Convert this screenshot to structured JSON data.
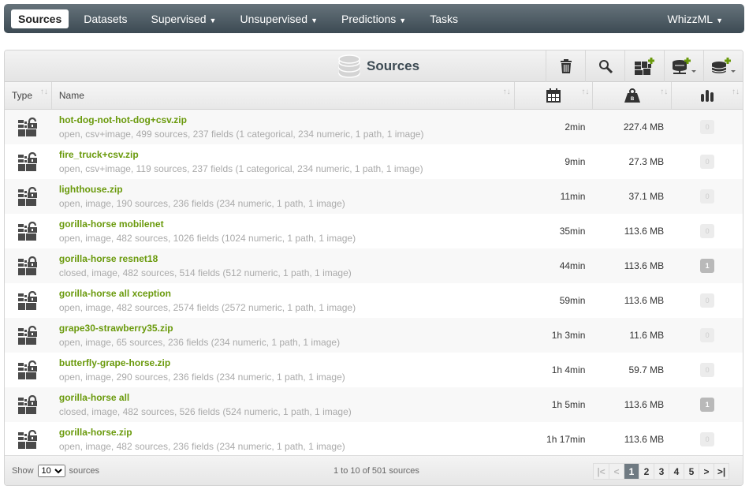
{
  "nav": {
    "items": [
      {
        "label": "Sources",
        "active": true
      },
      {
        "label": "Datasets"
      },
      {
        "label": "Supervised",
        "dropdown": true
      },
      {
        "label": "Unsupervised",
        "dropdown": true
      },
      {
        "label": "Predictions",
        "dropdown": true
      },
      {
        "label": "Tasks"
      }
    ],
    "right": {
      "label": "WhizzML",
      "dropdown": true
    }
  },
  "panel": {
    "title": "Sources",
    "tools": [
      "trash-icon",
      "search-icon",
      "add-composite-source-icon",
      "add-remote-source-icon",
      "add-source-icon"
    ]
  },
  "columns": {
    "type": "Type",
    "name": "Name",
    "age_icon": "calendar-icon",
    "size_icon": "weight-icon",
    "count_icon": "bar-chart-icon"
  },
  "rows": [
    {
      "name": "hot-dog-not-hot-dog+csv.zip",
      "desc": "open, csv+image, 499 sources, 237 fields (1 categorical, 234 numeric, 1 path, 1 image)",
      "age": "2min",
      "size": "227.4 MB",
      "count": "0",
      "closed": false
    },
    {
      "name": "fire_truck+csv.zip",
      "desc": "open, csv+image, 119 sources, 237 fields (1 categorical, 234 numeric, 1 path, 1 image)",
      "age": "9min",
      "size": "27.3 MB",
      "count": "0",
      "closed": false
    },
    {
      "name": "lighthouse.zip",
      "desc": "open, image, 190 sources, 236 fields (234 numeric, 1 path, 1 image)",
      "age": "11min",
      "size": "37.1 MB",
      "count": "0",
      "closed": false
    },
    {
      "name": "gorilla-horse mobilenet",
      "desc": "open, image, 482 sources, 1026 fields (1024 numeric, 1 path, 1 image)",
      "age": "35min",
      "size": "113.6 MB",
      "count": "0",
      "closed": false
    },
    {
      "name": "gorilla-horse resnet18",
      "desc": "closed, image, 482 sources, 514 fields (512 numeric, 1 path, 1 image)",
      "age": "44min",
      "size": "113.6 MB",
      "count": "1",
      "closed": true
    },
    {
      "name": "gorilla-horse all xception",
      "desc": "open, image, 482 sources, 2574 fields (2572 numeric, 1 path, 1 image)",
      "age": "59min",
      "size": "113.6 MB",
      "count": "0",
      "closed": false
    },
    {
      "name": "grape30-strawberry35.zip",
      "desc": "open, image, 65 sources, 236 fields (234 numeric, 1 path, 1 image)",
      "age": "1h 3min",
      "size": "11.6 MB",
      "count": "0",
      "closed": false
    },
    {
      "name": "butterfly-grape-horse.zip",
      "desc": "open, image, 290 sources, 236 fields (234 numeric, 1 path, 1 image)",
      "age": "1h 4min",
      "size": "59.7 MB",
      "count": "0",
      "closed": false
    },
    {
      "name": "gorilla-horse all",
      "desc": "closed, image, 482 sources, 526 fields (524 numeric, 1 path, 1 image)",
      "age": "1h 5min",
      "size": "113.6 MB",
      "count": "1",
      "closed": true
    },
    {
      "name": "gorilla-horse.zip",
      "desc": "open, image, 482 sources, 236 fields (234 numeric, 1 path, 1 image)",
      "age": "1h 17min",
      "size": "113.6 MB",
      "count": "0",
      "closed": false
    }
  ],
  "footer": {
    "show_label": "Show",
    "page_size": "10",
    "sources_label": "sources",
    "info": "1 to 10 of 501 sources",
    "pages": [
      "1",
      "2",
      "3",
      "4",
      "5"
    ],
    "current_page": "1"
  },
  "colors": {
    "accent": "#6a9a0c",
    "nav": "#3c4a53"
  }
}
